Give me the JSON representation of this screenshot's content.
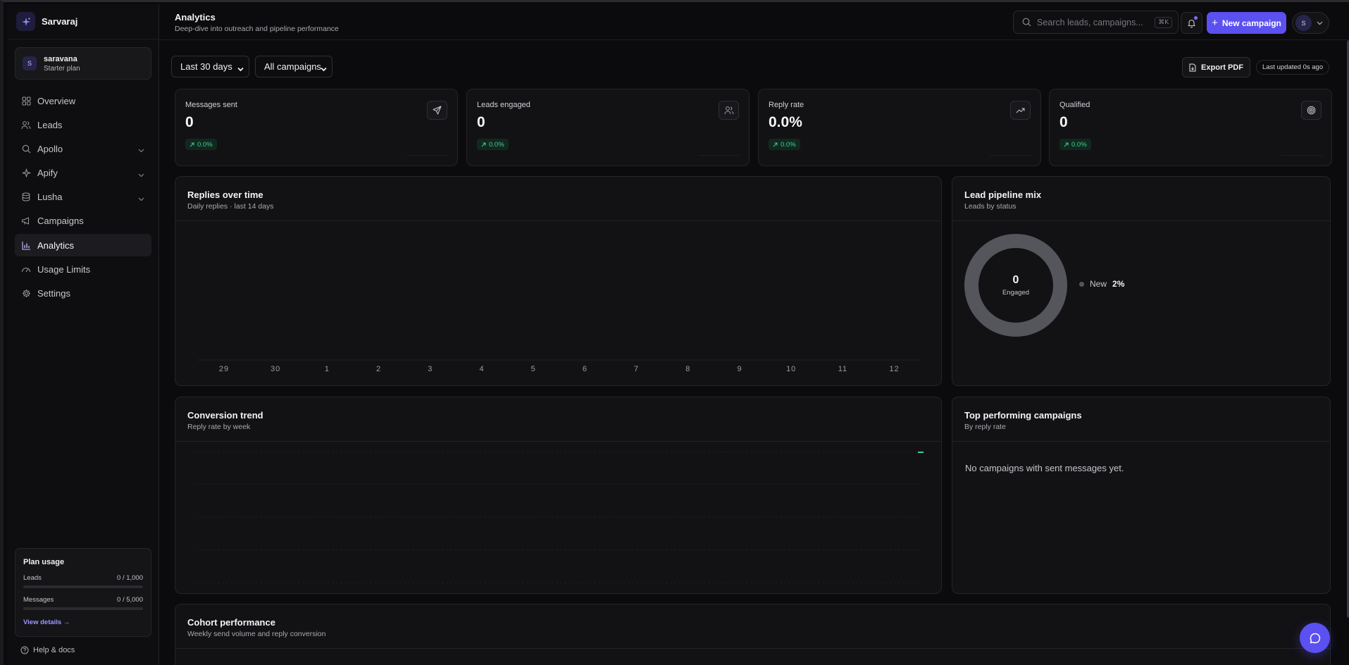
{
  "brand": {
    "name": "Sarvaraj"
  },
  "user": {
    "initial": "S",
    "name": "saravana",
    "plan": "Starter plan"
  },
  "nav": [
    {
      "label": "Overview",
      "icon": "grid-icon",
      "expandable": false,
      "active": false
    },
    {
      "label": "Leads",
      "icon": "users-icon",
      "expandable": false,
      "active": false
    },
    {
      "label": "Apollo",
      "icon": "search-icon",
      "expandable": true,
      "active": false
    },
    {
      "label": "Apify",
      "icon": "sparkle-icon",
      "expandable": true,
      "active": false
    },
    {
      "label": "Lusha",
      "icon": "database-icon",
      "expandable": true,
      "active": false
    },
    {
      "label": "Campaigns",
      "icon": "megaphone-icon",
      "expandable": false,
      "active": false
    },
    {
      "label": "Analytics",
      "icon": "bar-chart-icon",
      "expandable": false,
      "active": true
    },
    {
      "label": "Usage Limits",
      "icon": "gauge-icon",
      "expandable": false,
      "active": false
    },
    {
      "label": "Settings",
      "icon": "gear-icon",
      "expandable": false,
      "active": false
    }
  ],
  "plan_usage": {
    "title": "Plan usage",
    "rows": [
      {
        "label": "Leads",
        "value": "0 / 1,000",
        "used": 0
      },
      {
        "label": "Messages",
        "value": "0 / 5,000",
        "used": 0
      }
    ],
    "link": "View details →"
  },
  "help": {
    "label": "Help & docs"
  },
  "header": {
    "title": "Analytics",
    "subtitle": "Deep-dive into outreach and pipeline performance",
    "search_placeholder": "Search leads, campaigns...",
    "shortcut": "⌘K",
    "new_button": "New campaign",
    "avatar_initial": "S"
  },
  "filters": {
    "range": {
      "selected": "Last 30 days",
      "options": [
        "Last 30 days"
      ]
    },
    "campaign": {
      "selected": "All campaigns",
      "options": [
        "All campaigns"
      ]
    },
    "export_label": "Export PDF",
    "updated": "Last updated 0s ago"
  },
  "stats": [
    {
      "label": "Messages sent",
      "value": "0",
      "delta": "0.0%",
      "icon": "send-icon"
    },
    {
      "label": "Leads engaged",
      "value": "0",
      "delta": "0.0%",
      "icon": "users-icon"
    },
    {
      "label": "Reply rate",
      "value": "0.0%",
      "delta": "0.0%",
      "icon": "trending-up-icon"
    },
    {
      "label": "Qualified",
      "value": "0",
      "delta": "0.0%",
      "icon": "target-icon"
    }
  ],
  "replies_panel": {
    "title": "Replies over time",
    "subtitle": "Daily replies · last 14 days"
  },
  "pipeline_panel": {
    "title": "Lead pipeline mix",
    "subtitle": "Leads by status",
    "center_value": "0",
    "center_label": "Engaged",
    "legend": [
      {
        "label": "New",
        "pct": "2%",
        "color": "#55555c"
      }
    ]
  },
  "conversion_panel": {
    "title": "Conversion trend",
    "subtitle": "Reply rate by week"
  },
  "top_campaigns_panel": {
    "title": "Top performing campaigns",
    "subtitle": "By reply rate",
    "empty": "No campaigns with sent messages yet."
  },
  "cohort_panel": {
    "title": "Cohort performance",
    "subtitle": "Weekly send volume and reply conversion"
  },
  "colors": {
    "accent": "#5b50f0",
    "positive": "#3fd18f",
    "background": "#0b0b0d",
    "card": "#121215"
  },
  "chart_data": [
    {
      "type": "bar",
      "categories": [
        "29",
        "30",
        "1",
        "2",
        "3",
        "4",
        "5",
        "6",
        "7",
        "8",
        "9",
        "10",
        "11",
        "12"
      ],
      "values": [
        0,
        0,
        0,
        0,
        0,
        0,
        0,
        0,
        0,
        0,
        0,
        0,
        0,
        0
      ],
      "title": "Replies over time",
      "subtitle": "Daily replies · last 14 days",
      "grid": false
    },
    {
      "type": "pie",
      "categories": [
        "New"
      ],
      "values": [
        100
      ],
      "title": "Lead pipeline mix",
      "subtitle": "Leads by status"
    },
    {
      "type": "line",
      "title": "Conversion trend",
      "subtitle": "Reply rate by week",
      "series": [
        {
          "values": [
            0
          ]
        }
      ],
      "grid": true
    }
  ]
}
